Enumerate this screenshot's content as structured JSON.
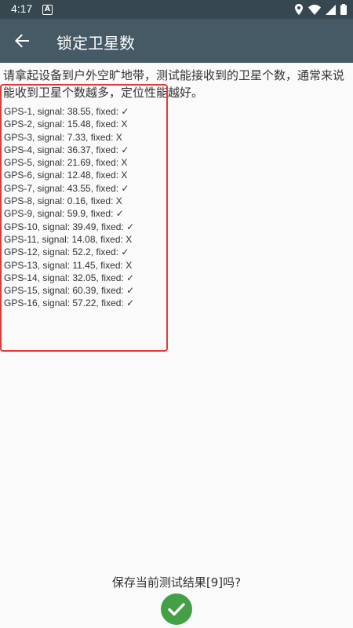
{
  "status_bar": {
    "time": "4:17",
    "notification_icon": "A",
    "icons": [
      "location-icon",
      "wifi-icon",
      "signal-icon",
      "battery-icon"
    ]
  },
  "app_bar": {
    "title": "锁定卫星数",
    "back_icon": "arrow-back-icon",
    "color": "#455a64"
  },
  "instruction": "请拿起设备到户外空旷地带，测试能接收到的卫星个数，通常来说能收到卫星个数越多，定位性能越好。",
  "satellites": [
    "GPS-1, signal: 38.55, fixed: ✓",
    "GPS-2, signal: 15.48, fixed: X",
    "GPS-3, signal: 7.33, fixed: X",
    "GPS-4, signal: 36.37, fixed: ✓",
    "GPS-5, signal: 21.69, fixed: X",
    "GPS-6, signal: 12.48, fixed: X",
    "GPS-7, signal: 43.55, fixed: ✓",
    "GPS-8, signal: 0.16, fixed: X",
    "GPS-9, signal: 59.9, fixed: ✓",
    "GPS-10, signal: 39.49, fixed: ✓",
    "GPS-11, signal: 14.08, fixed: X",
    "GPS-12, signal: 52.2, fixed: ✓",
    "GPS-13, signal: 11.45, fixed: X",
    "GPS-14, signal: 32.05, fixed: ✓",
    "GPS-15, signal: 60.39, fixed: ✓",
    "GPS-16, signal: 57.22, fixed: ✓"
  ],
  "footer": {
    "save_prompt": "保存当前测试结果[9]吗?",
    "confirm_icon": "checkmark-icon",
    "confirm_color": "#43a047"
  }
}
